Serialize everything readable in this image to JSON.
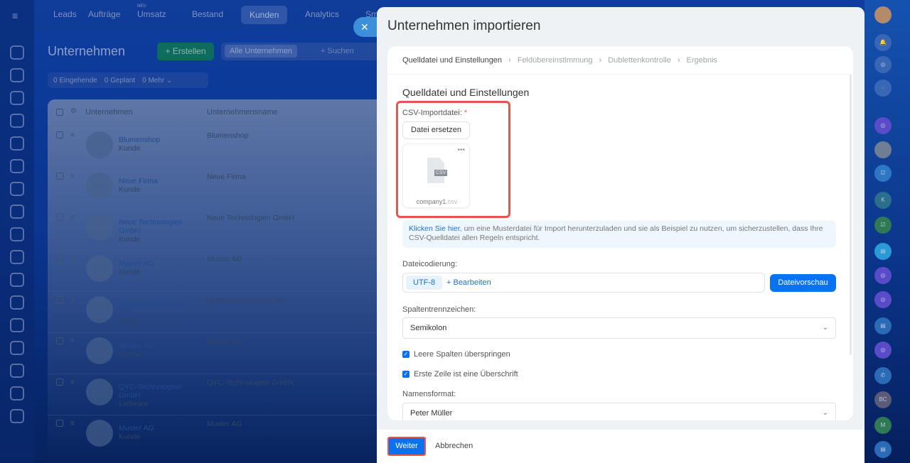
{
  "topnav": {
    "items": [
      "Leads",
      "Aufträge",
      "Umsatz",
      "Bestand",
      "Kunden",
      "Analytics",
      "Sm"
    ],
    "new_badge": "NEU"
  },
  "page": {
    "title": "Unternehmen",
    "create": "+ Erstellen",
    "filter_chip": "Alle Unternehmen",
    "search_placeholder": "+ Suchen",
    "counters": [
      {
        "n": "0",
        "label": "Eingehende"
      },
      {
        "n": "0",
        "label": "Geplant"
      },
      {
        "n": "0",
        "label": "Mehr"
      }
    ]
  },
  "table": {
    "headers": [
      "Unternehmen",
      "Unternehmensname"
    ],
    "rows": [
      {
        "name": "Blumenshop",
        "type": "Kunde",
        "col2": "Blumenshop"
      },
      {
        "name": "Neue Firma",
        "type": "Kunde",
        "col2": "Neue Firma"
      },
      {
        "name": "Neue Technologien GmbH",
        "type": "Kunde",
        "col2": "Neue Technologien GmbH"
      },
      {
        "name": "Muster AG",
        "type": "Kunde",
        "col2": "Muster AG"
      },
      {
        "name": "Musterunternehmen AG",
        "type": "Kunde",
        "col2": "Musterunternehmen AG"
      },
      {
        "name": "Muster AG",
        "type": "Kunde",
        "col2": "Muster AG"
      },
      {
        "name": "QYC-Technologien GmbH",
        "type": "Lieferant",
        "col2": "QYC-Technologien GmbH"
      },
      {
        "name": "Muster AG",
        "type": "Kunde",
        "col2": "Muster AG"
      }
    ]
  },
  "dialog": {
    "title": "Unternehmen importieren",
    "steps": [
      "Quelldatei und Einstellungen",
      "Feldübereinstimmung",
      "Dublettenkontrolle",
      "Ergebnis"
    ],
    "section_title": "Quelldatei und Einstellungen",
    "csv_label": "CSV-Importdatei:",
    "required": "*",
    "replace_button": "Datei ersetzen",
    "file": {
      "name": "company1",
      "ext": ".csv",
      "badge": "CSV"
    },
    "info_link": "Klicken Sie hier",
    "info_text": ", um eine Musterdatei für Import herunterzuladen und sie als Beispiel zu nutzen, um sicherzustellen, dass Ihre CSV-Quelldatei allen Regeln entspricht.",
    "encoding_label": "Dateicodierung:",
    "encoding_value": "UTF-8",
    "encoding_edit": "+ Bearbeiten",
    "preview_button": "Dateivorschau",
    "separator_label": "Spaltentrennzeichen:",
    "separator_value": "Semikolon",
    "skip_empty": "Leere Spalten überspringen",
    "first_row_header": "Erste Zeile ist eine Überschrift",
    "name_format_label": "Namensformat:",
    "name_format_value": "Peter Müller",
    "next_button": "Weiter",
    "cancel_button": "Abbrechen"
  },
  "rightbar": {
    "letters": [
      "K",
      "BC",
      "M"
    ]
  }
}
